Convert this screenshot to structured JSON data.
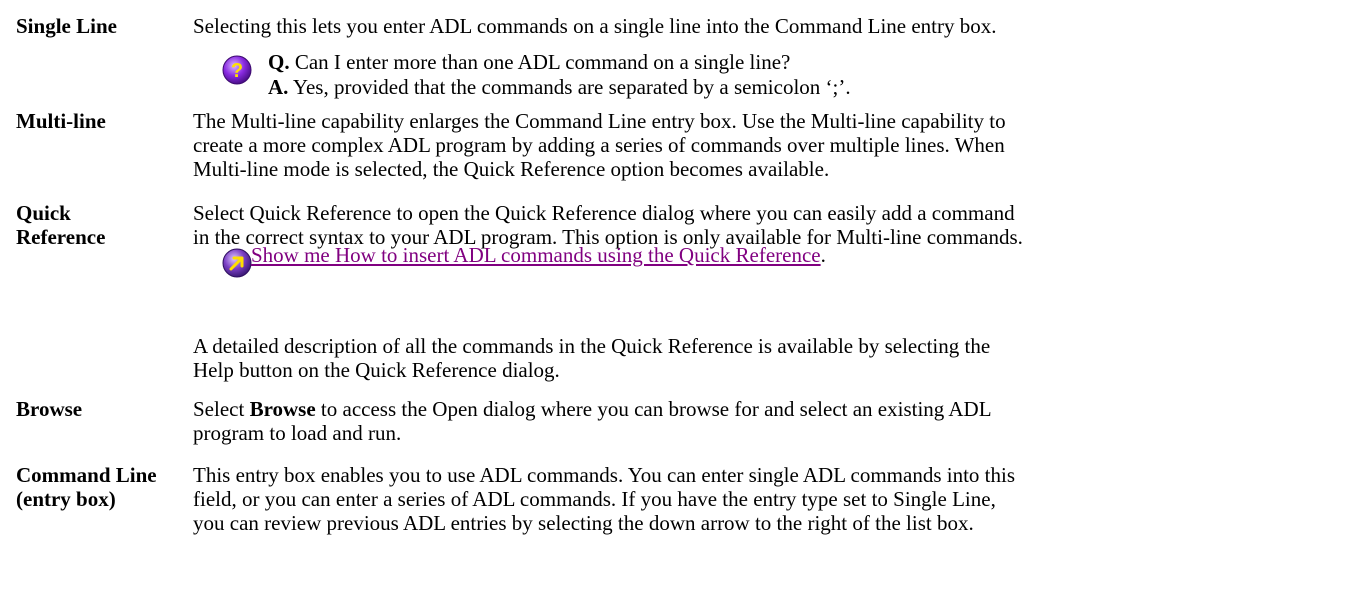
{
  "entries": {
    "single_line": {
      "term": "Single Line",
      "desc": "Selecting this lets you enter ADL commands on a single line into the Command Line entry box.",
      "q_label": "Q.",
      "q_text": " Can I enter more than one ADL command on a single line?",
      "a_label": "A.",
      "a_text": " Yes, provided that the commands are separated by a semicolon ‘;’."
    },
    "multi_line": {
      "term": "Multi-line",
      "lines": [
        "The Multi-line capability enlarges the Command Line entry box. Use the Multi-line capability to",
        "create a more complex ADL program by adding a series of commands over multiple lines. When",
        "Multi-line mode is selected, the Quick Reference option becomes available."
      ]
    },
    "quick_reference": {
      "term_1": "Quick",
      "term_2": "Reference",
      "lines": [
        "Select Quick Reference to open the Quick Reference dialog where you can easily add a command",
        "in the correct syntax to your ADL program. This option is only available for Multi-line commands."
      ],
      "link_text": "Show me How to insert ADL commands using the Quick Reference",
      "link_suffix": ".",
      "extra_lines": [
        "A detailed description of all the commands in the Quick Reference is available by selecting the",
        "Help button on the Quick Reference dialog."
      ]
    },
    "browse": {
      "term": "Browse",
      "pre": "Select ",
      "bold": "Browse",
      "post_line1": " to access the Open dialog where you can browse for and select an existing ADL",
      "line2": "program to load and run."
    },
    "command_line": {
      "term_1": "Command Line",
      "term_2": "(entry box)",
      "lines": [
        "This entry box enables you to use ADL commands. You can enter single ADL commands into this",
        "field, or you can enter a series of ADL commands. If you have the entry type set to Single Line,",
        "you can review previous ADL entries by selecting the down arrow to the right of the list box."
      ]
    }
  },
  "colors": {
    "text": "#000000",
    "link": "#800080",
    "question_icon": "#8a2be2",
    "arrow_icon": "#7b3fc4"
  }
}
